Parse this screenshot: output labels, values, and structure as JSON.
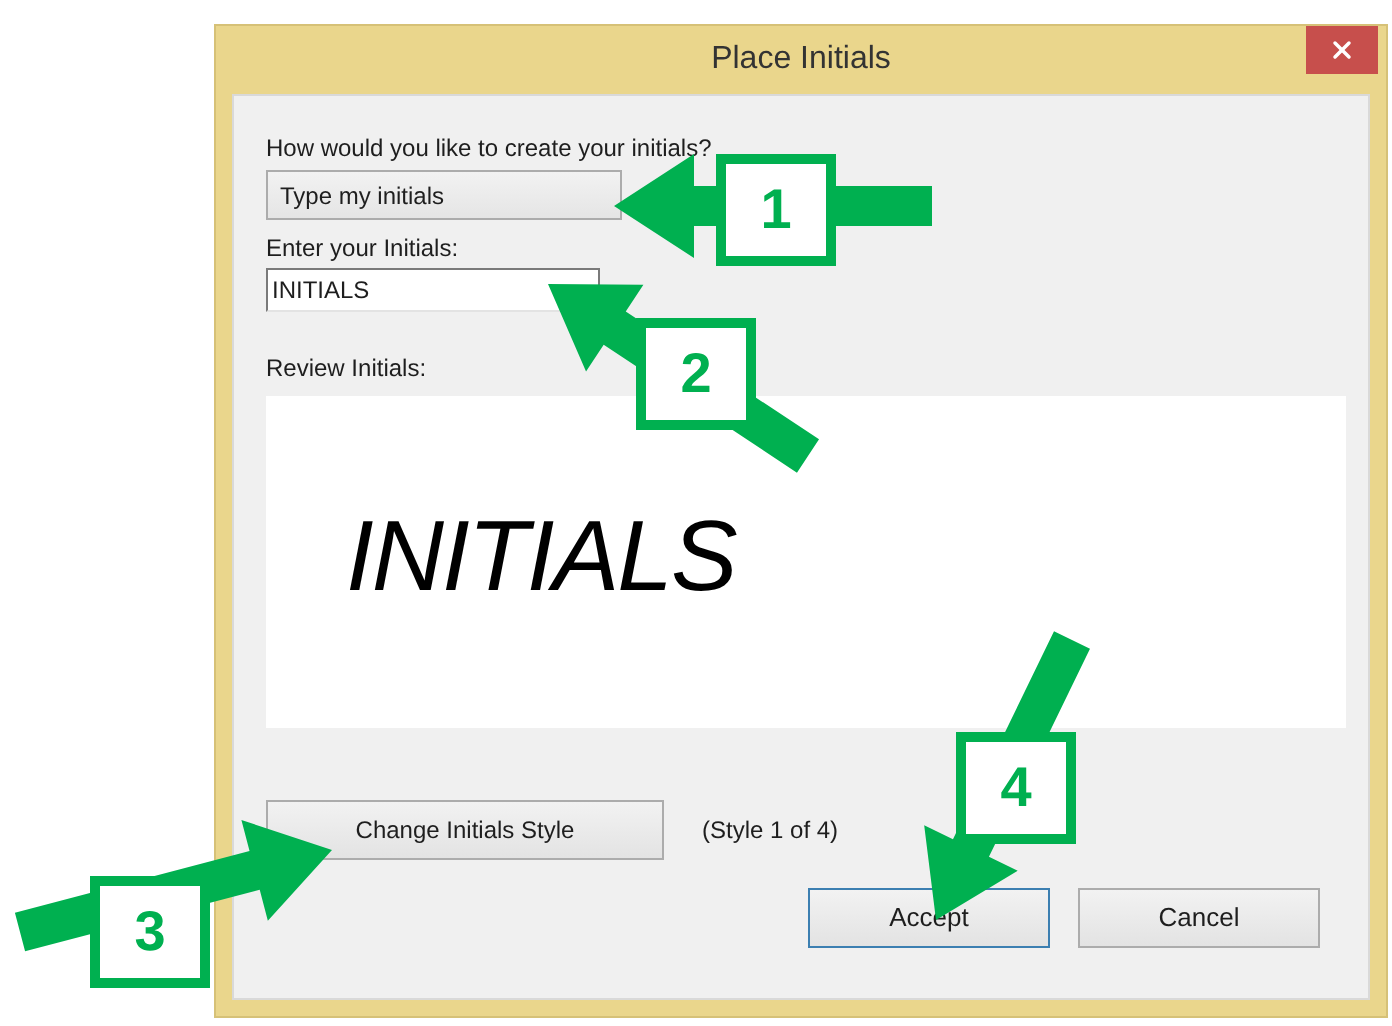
{
  "window": {
    "title": "Place Initials"
  },
  "method": {
    "label": "How would you like to create your initials?",
    "value": "Type my initials"
  },
  "initials_field": {
    "label": "Enter your Initials:",
    "value": "INITIALS"
  },
  "review": {
    "label": "Review Initials:",
    "preview": "INITIALS"
  },
  "style_button": {
    "label": "Change Initials Style",
    "status": "(Style 1 of 4)"
  },
  "buttons": [
    {
      "label": "Accept",
      "default": true
    },
    {
      "label": "Cancel",
      "default": false
    }
  ],
  "callouts": [
    {
      "label": "1"
    },
    {
      "label": "2"
    },
    {
      "label": "3"
    },
    {
      "label": "4"
    }
  ]
}
